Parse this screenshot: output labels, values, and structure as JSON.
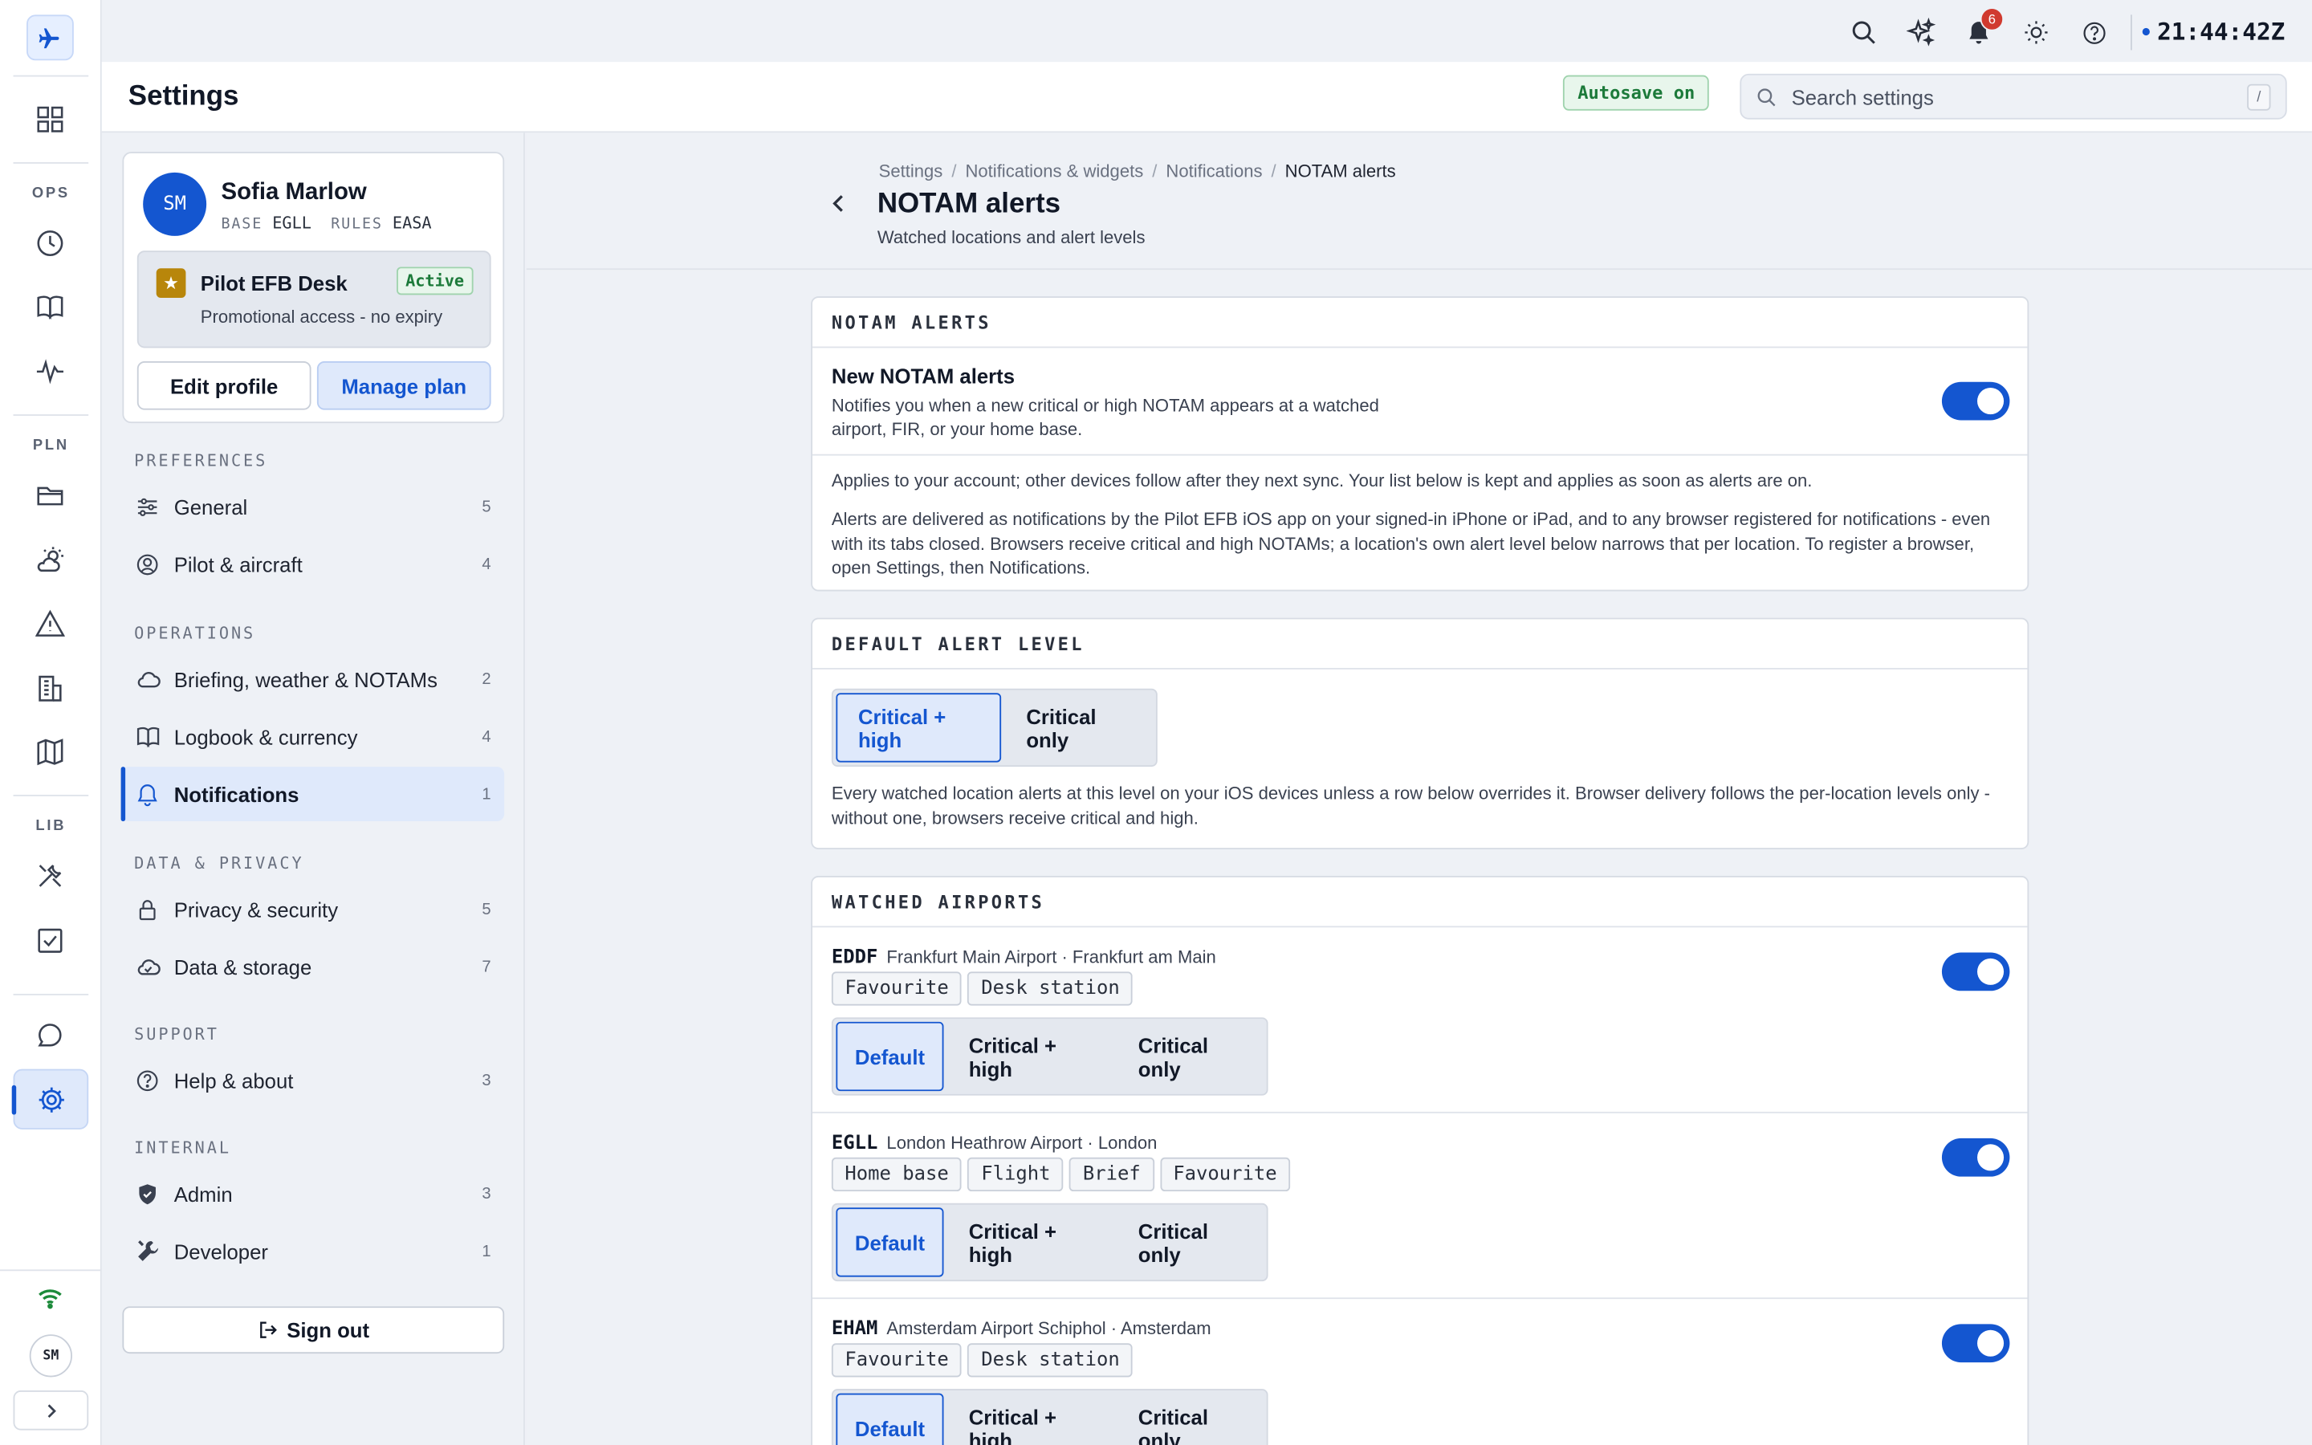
{
  "rail": {
    "sections": [
      "OPS",
      "PLN",
      "LIB"
    ]
  },
  "topbar": {
    "notification_count": "6",
    "clock": "21:44:42Z"
  },
  "header": {
    "title": "Settings",
    "autosave": "Autosave on",
    "search_placeholder": "Search settings",
    "search_shortcut": "/"
  },
  "profile": {
    "initials": "SM",
    "name": "Sofia Marlow",
    "base_key": "BASE",
    "base": "EGLL",
    "rules_key": "RULES",
    "rules": "EASA",
    "plan_name": "Pilot EFB Desk",
    "plan_status": "Active",
    "plan_note": "Promotional access - no expiry",
    "edit_label": "Edit profile",
    "manage_label": "Manage plan"
  },
  "nav": {
    "groups": [
      "PREFERENCES",
      "OPERATIONS",
      "DATA & PRIVACY",
      "SUPPORT",
      "INTERNAL"
    ],
    "items": [
      {
        "label": "General",
        "count": "5"
      },
      {
        "label": "Pilot & aircraft",
        "count": "4"
      },
      {
        "label": "Briefing, weather & NOTAMs",
        "count": "2"
      },
      {
        "label": "Logbook & currency",
        "count": "4"
      },
      {
        "label": "Notifications",
        "count": "1"
      },
      {
        "label": "Privacy & security",
        "count": "5"
      },
      {
        "label": "Data & storage",
        "count": "7"
      },
      {
        "label": "Help & about",
        "count": "3"
      },
      {
        "label": "Admin",
        "count": "3"
      },
      {
        "label": "Developer",
        "count": "1"
      }
    ],
    "signout": "Sign out"
  },
  "page": {
    "breadcrumb": [
      "Settings",
      "Notifications & widgets",
      "Notifications",
      "NOTAM alerts"
    ],
    "title": "NOTAM alerts",
    "subtitle": "Watched locations and alert levels"
  },
  "notam_card": {
    "heading": "NOTAM ALERTS",
    "toggle_title": "New NOTAM alerts",
    "toggle_desc_1": "Notifies you when a new critical or high NOTAM appears at a watched",
    "toggle_desc_2": "airport, FIR, or your home base.",
    "toggle_on": true,
    "info_1": "Applies to your account; other devices follow after they next sync. Your list below is kept and applies as soon as alerts are on.",
    "info_2a": "Alerts are delivered as notifications by the Pilot EFB iOS app on your signed-in iPhone or iPad, and to any browser registered for notifications - even",
    "info_2b": "with its tabs closed. Browsers receive critical and high NOTAMs; a location's own alert level below narrows that per location. To register a browser,",
    "info_2c": "open Settings, then Notifications."
  },
  "default_level": {
    "heading": "DEFAULT ALERT LEVEL",
    "options": [
      "Critical + high",
      "Critical only"
    ],
    "selected": "Critical + high",
    "note_1": "Every watched location alerts at this level on your iOS devices unless a row below overrides it. Browser delivery follows the per-location levels only -",
    "note_2": "without one, browsers receive critical and high."
  },
  "watched": {
    "heading": "WATCHED AIRPORTS",
    "level_options": [
      "Default",
      "Critical + high",
      "Critical only"
    ],
    "airports": [
      {
        "icao": "EDDF",
        "name": "Frankfurt Main Airport · Frankfurt am Main",
        "tags": [
          "Favourite",
          "Desk station"
        ],
        "enabled": true,
        "level": "Default"
      },
      {
        "icao": "EGLL",
        "name": "London Heathrow Airport · London",
        "tags": [
          "Home base",
          "Flight",
          "Brief",
          "Favourite"
        ],
        "enabled": true,
        "level": "Default"
      },
      {
        "icao": "EHAM",
        "name": "Amsterdam Airport Schiphol · Amsterdam",
        "tags": [
          "Favourite",
          "Desk station"
        ],
        "enabled": true,
        "level": "Default"
      }
    ]
  },
  "colors": {
    "accent": "#1456d0",
    "success": "#1c7a3a",
    "danger": "#d03a2f"
  }
}
